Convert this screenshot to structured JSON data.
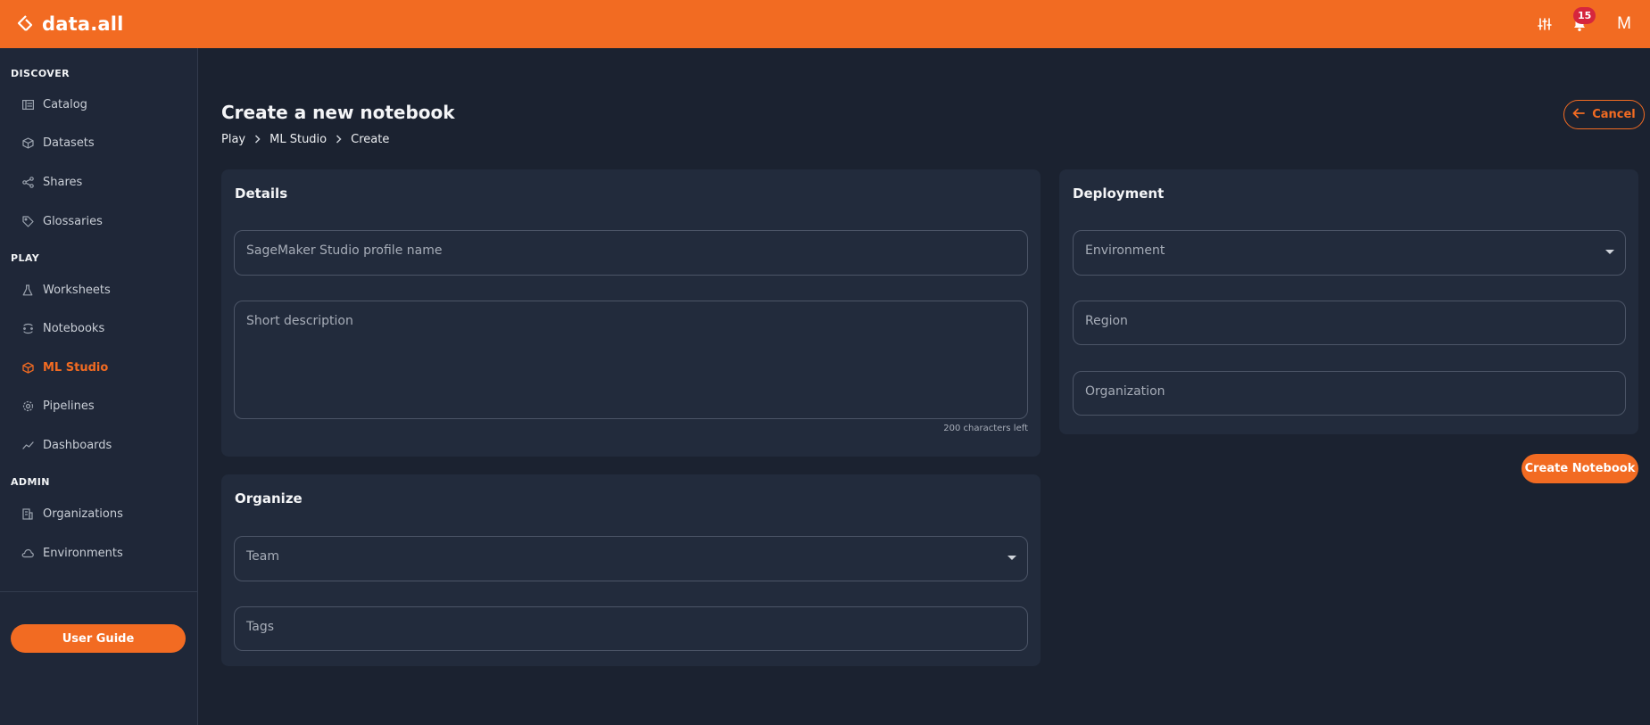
{
  "app": {
    "name": "data.all"
  },
  "topbar": {
    "settings_icon": "sliders-icon",
    "notifications_icon": "bell-icon",
    "notification_count": "15",
    "avatar_initial": "M"
  },
  "sidebar": {
    "sections": [
      {
        "title": "DISCOVER",
        "items": [
          {
            "label": "Catalog",
            "icon": "catalog-icon"
          },
          {
            "label": "Datasets",
            "icon": "cube-icon"
          },
          {
            "label": "Shares",
            "icon": "share-icon"
          },
          {
            "label": "Glossaries",
            "icon": "tag-icon"
          }
        ]
      },
      {
        "title": "PLAY",
        "items": [
          {
            "label": "Worksheets",
            "icon": "flask-icon"
          },
          {
            "label": "Notebooks",
            "icon": "notebook-icon"
          },
          {
            "label": "ML Studio",
            "icon": "cube-icon",
            "active": true
          },
          {
            "label": "Pipelines",
            "icon": "gear-icon"
          },
          {
            "label": "Dashboards",
            "icon": "trend-icon"
          }
        ]
      },
      {
        "title": "ADMIN",
        "items": [
          {
            "label": "Organizations",
            "icon": "building-icon"
          },
          {
            "label": "Environments",
            "icon": "cloud-icon"
          }
        ]
      }
    ],
    "user_guide_label": "User Guide"
  },
  "page": {
    "title": "Create a new notebook",
    "breadcrumb": [
      "Play",
      "ML Studio",
      "Create"
    ],
    "cancel_label": "Cancel"
  },
  "details": {
    "title": "Details",
    "profile_name_placeholder": "SageMaker Studio profile name",
    "profile_name_value": "",
    "description_placeholder": "Short description",
    "description_value": "",
    "chars_left": "200 characters left"
  },
  "organize": {
    "title": "Organize",
    "team_placeholder": "Team",
    "tags_placeholder": "Tags"
  },
  "deployment": {
    "title": "Deployment",
    "environment_placeholder": "Environment",
    "region_placeholder": "Region",
    "organization_placeholder": "Organization"
  },
  "actions": {
    "create_label": "Create Notebook"
  },
  "colors": {
    "accent": "#f26b22",
    "background": "#1b2230",
    "card": "#222b3c",
    "sidebar": "#1f2738",
    "badge": "#d6263d"
  }
}
